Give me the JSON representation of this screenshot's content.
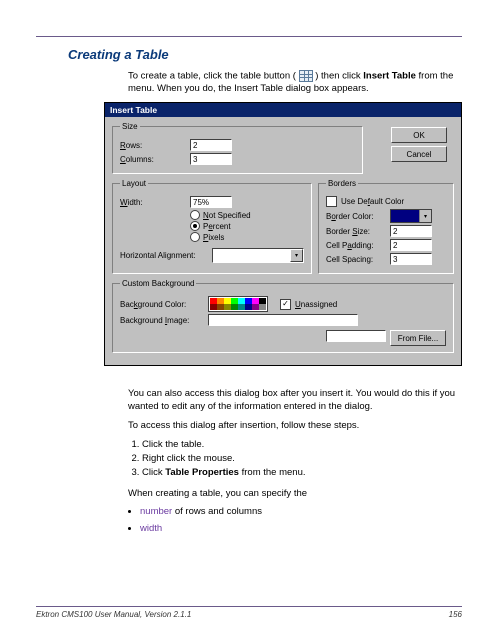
{
  "heading": "Creating a Table",
  "intro": {
    "line1a": "To create a table, click the table button (",
    "line1b": ") then click ",
    "insertTable": "Insert Table",
    "line1c": " from the menu. When you do, the Insert Table dialog box appears."
  },
  "dialog": {
    "title": "Insert Table",
    "okLabel": "OK",
    "cancelLabel": "Cancel",
    "size": {
      "legend": "Size",
      "rowsLabel": "Rows:",
      "rowsValue": "2",
      "colsLabel": "Columns:",
      "colsValue": "3"
    },
    "layout": {
      "legend": "Layout",
      "widthLabel": "Width:",
      "widthValue": "75%",
      "notSpecified": "Not Specified",
      "percent": "Percent",
      "pixels": "Pixels",
      "hAlignLabel": "Horizontal Alignment:"
    },
    "borders": {
      "legend": "Borders",
      "useDefaultColor": "Use Default Color",
      "borderColorLabel": "Border Color:",
      "borderColorValue": "#000080",
      "borderSizeLabel": "Border Size:",
      "borderSizeValue": "2",
      "cellPaddingLabel": "Cell Padding:",
      "cellPaddingValue": "2",
      "cellSpacingLabel": "Cell Spacing:",
      "cellSpacingValue": "3"
    },
    "customBg": {
      "legend": "Custom Background",
      "bgColorLabel": "Background Color:",
      "unassignedLabel": "Unassigned",
      "bgImageLabel": "Background Image:",
      "fromFileLabel": "From File..."
    }
  },
  "para2": "You can also access this dialog box after you insert it. You would do this if you wanted to edit any of the information entered in the dialog.",
  "para3": "To access this dialog after insertion, follow these steps.",
  "steps": [
    "Click the table.",
    "Right click the mouse.",
    {
      "pre": "Click ",
      "bold": "Table Properties",
      "post": " from the menu."
    }
  ],
  "para4": "When creating a table, you can specify the",
  "bullets": [
    {
      "highlight": "number",
      "rest": " of rows and columns"
    },
    {
      "highlight": "width",
      "rest": ""
    }
  ],
  "footer": {
    "left": "Ektron CMS100 User Manual, Version 2.1.1",
    "right": "156"
  }
}
